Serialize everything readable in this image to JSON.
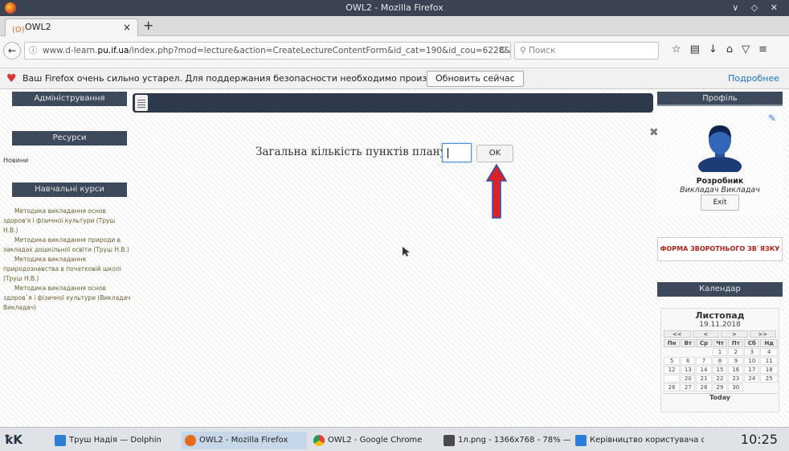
{
  "window": {
    "title": "OWL2 - Mozilla Firefox"
  },
  "tab": {
    "label": "OWL2",
    "close": "×",
    "new": "+"
  },
  "nav": {
    "url_pre": "www.d-learn.",
    "url_domain": "pu.if.ua",
    "url_post": "/index.php?mod=lecture&action=CreateLectureContentForm&id_cat=190&id_cou=6228&step=2&id_l=20",
    "search_placeholder": "Поиск"
  },
  "notification": {
    "text": "Ваш Firefox очень сильно устарел. Для поддержания безопасности необходимо произвести обновление.",
    "button": "Обновить сейчас",
    "more": "Подробнее"
  },
  "left": {
    "admin": "Адміністрування",
    "resources": "Ресурси",
    "news": "Новини",
    "courses_header": "Навчальні курси",
    "courses": [
      "Методика викладання основ здоров'я і фізичної культури (Труш Н.В.)",
      "Методика викладання природи в закладах дошкільної освіти (Труш Н.В.)",
      "Методика викладання природознавства в початковій школі (Труш Н.В.)",
      "Методика викладання основ здоров`я і фізичної культури (Викладач Викладач)"
    ]
  },
  "main": {
    "prompt": "Загальна кількість пунктів плану:",
    "input_value": "",
    "ok": "OK",
    "close_icon": "close-icon"
  },
  "right": {
    "profile_header": "Профіль",
    "name": "Розробник",
    "role": "Викладач  Викладач",
    "exit": "Exit",
    "feedback": "ФОРМА ЗВОРОТНЬОГО ЗВ`ЯЗКУ",
    "calendar_header": "Календар",
    "calendar": {
      "month": "Листопад",
      "date": "19.11.2018",
      "nav": [
        "<<",
        "<",
        ">",
        ">>"
      ],
      "weekdays": [
        "Пн",
        "Вт",
        "Ср",
        "Чт",
        "Пт",
        "Сб",
        "Нд"
      ],
      "weeks": [
        [
          "",
          "",
          "",
          "1",
          "2",
          "3",
          "4"
        ],
        [
          "5",
          "6",
          "7",
          "8",
          "9",
          "10",
          "11"
        ],
        [
          "12",
          "13",
          "14",
          "15",
          "16",
          "17",
          "18"
        ],
        [
          "19",
          "20",
          "21",
          "22",
          "23",
          "24",
          "25"
        ],
        [
          "26",
          "27",
          "28",
          "29",
          "30",
          "",
          ""
        ]
      ],
      "today_day": "19",
      "today_label": "Today"
    }
  },
  "taskbar": {
    "items": [
      "Труш Надія — Dolphin",
      "OWL2 - Mozilla Firefox",
      "OWL2 - Google Chrome",
      "1л.png - 1366x768 - 78% — Gw",
      "Керівництво користувача d-le"
    ],
    "clock": "10:25"
  },
  "colors": {
    "accent": "#3c4a5c",
    "arrow": "#d8232a",
    "feedback": "#b0221b"
  }
}
